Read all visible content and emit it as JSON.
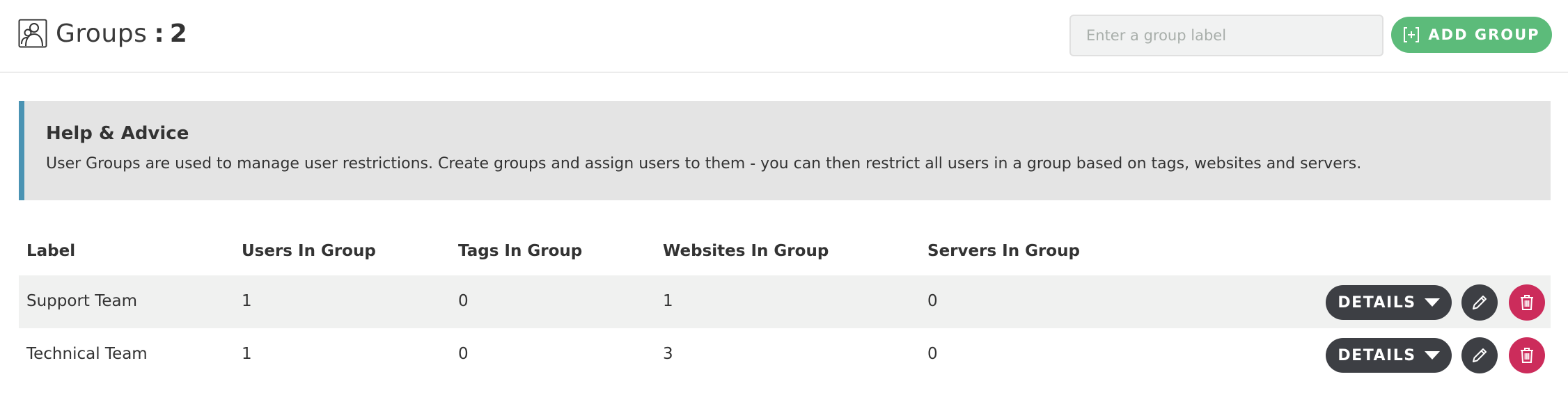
{
  "header": {
    "title": "Groups",
    "separator": ":",
    "count": "2",
    "input_placeholder": "Enter a group label",
    "add_button_label": "ADD GROUP",
    "icons": {
      "title": "users-group-icon",
      "add": "plus-square-icon"
    }
  },
  "help": {
    "title": "Help & Advice",
    "text": "User Groups are used to manage user restrictions. Create groups and assign users to them - you can then restrict all users in a group based on tags, websites and servers."
  },
  "table": {
    "columns": [
      "Label",
      "Users In Group",
      "Tags In Group",
      "Websites In Group",
      "Servers In Group"
    ],
    "rows": [
      {
        "label": "Support Team",
        "users": "1",
        "tags": "0",
        "websites": "1",
        "servers": "0",
        "details_label": "DETAILS"
      },
      {
        "label": "Technical Team",
        "users": "1",
        "tags": "0",
        "websites": "3",
        "servers": "0",
        "details_label": "DETAILS"
      }
    ]
  },
  "colors": {
    "accent_green": "#5cbb7a",
    "help_border": "#4a93b3",
    "dark_button": "#3d3f44",
    "delete_button": "#cc2c5b"
  }
}
